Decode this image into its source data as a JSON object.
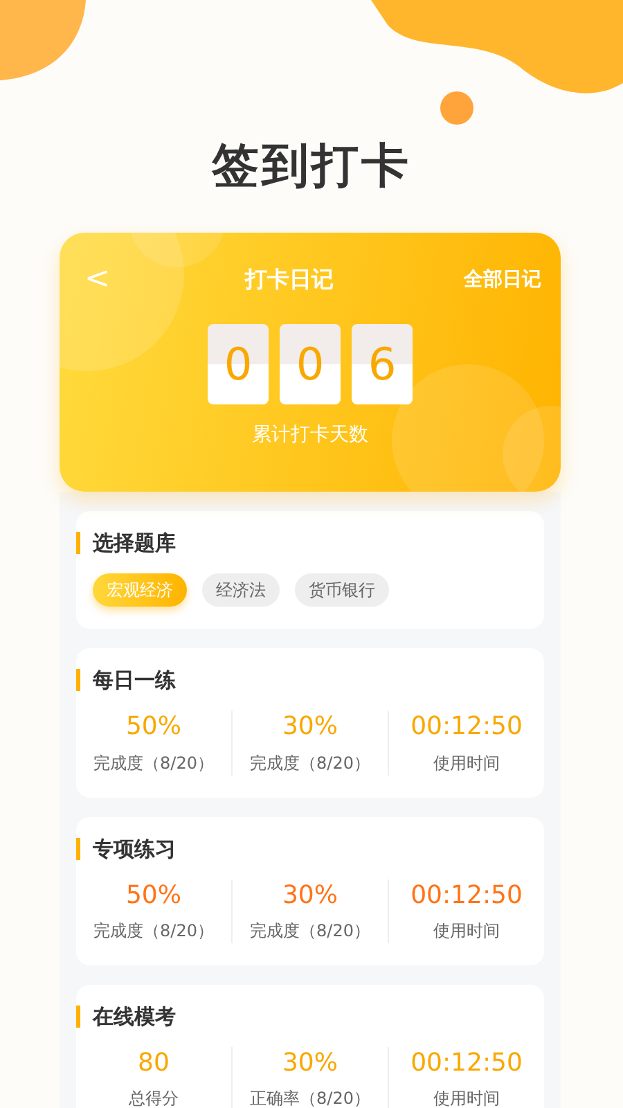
{
  "page_title": "签到打卡",
  "diary": {
    "back": "<",
    "title": "打卡日记",
    "all_link": "全部日记",
    "digits": [
      "0",
      "0",
      "6"
    ],
    "caption": "累计打卡天数"
  },
  "bank": {
    "title": "选择题库",
    "options": [
      {
        "label": "宏观经济",
        "selected": true
      },
      {
        "label": "经济法",
        "selected": false
      },
      {
        "label": "货币银行",
        "selected": false
      }
    ]
  },
  "sections": [
    {
      "title": "每日一练",
      "color": "#f9a800",
      "stats": [
        {
          "value": "50%",
          "label": "完成度（8/20）"
        },
        {
          "value": "30%",
          "label": "完成度（8/20）"
        },
        {
          "value": "00:12:50",
          "label": "使用时间"
        }
      ]
    },
    {
      "title": "专项练习",
      "color": "#ff7418",
      "stats": [
        {
          "value": "50%",
          "label": "完成度（8/20）"
        },
        {
          "value": "30%",
          "label": "完成度（8/20）"
        },
        {
          "value": "00:12:50",
          "label": "使用时间"
        }
      ]
    },
    {
      "title": "在线模考",
      "color": "#f9a800",
      "stats": [
        {
          "value": "80",
          "label": "总得分"
        },
        {
          "value": "30%",
          "label": "正确率（8/20）"
        },
        {
          "value": "00:12:50",
          "label": "使用时间"
        }
      ]
    }
  ]
}
